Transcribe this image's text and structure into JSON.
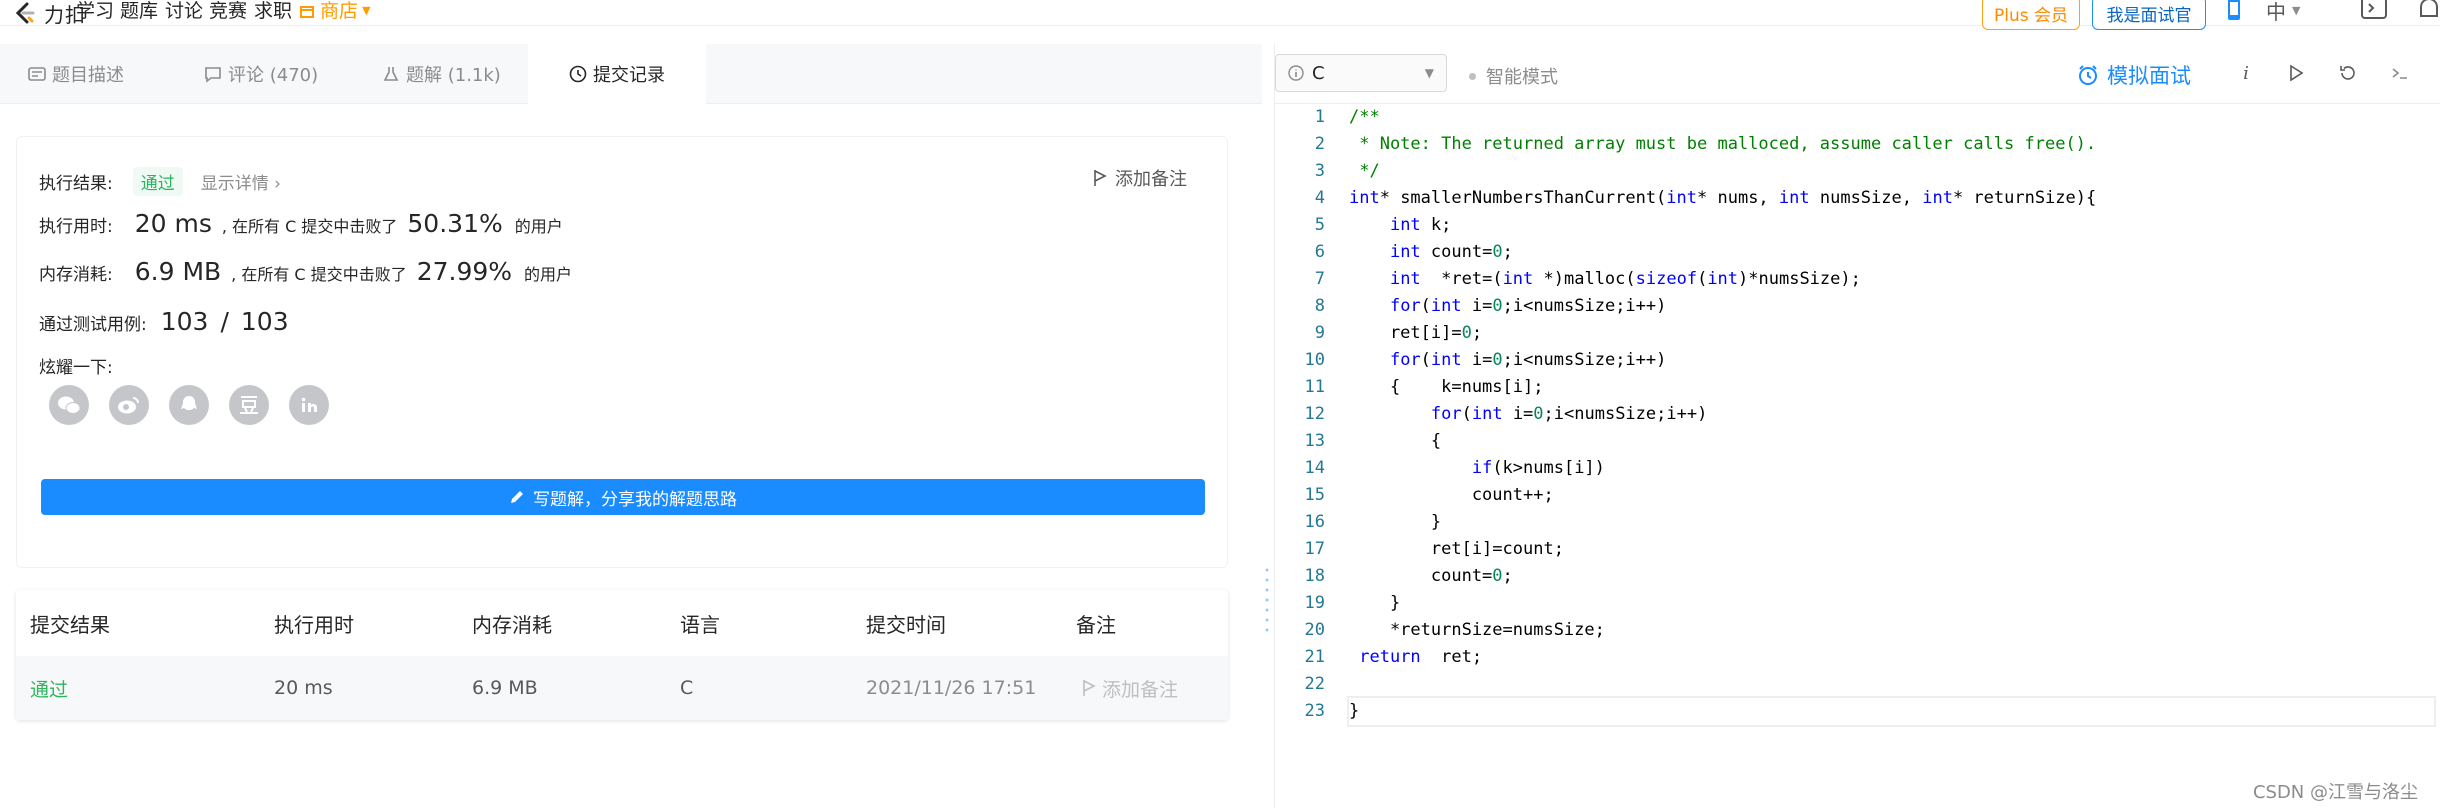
{
  "nav": {
    "logo_text": "力扣",
    "items": [
      "学习",
      "题库",
      "讨论",
      "竞赛",
      "求职"
    ],
    "store": "商店",
    "plus": "Plus 会员",
    "interviewer": "我是面试官",
    "lang": "中"
  },
  "tabs": [
    {
      "label": "题目描述",
      "icon": "description-icon"
    },
    {
      "label": "评论 (470)",
      "icon": "comment-icon"
    },
    {
      "label": "题解 (1.1k)",
      "icon": "flask-icon"
    },
    {
      "label": "提交记录",
      "icon": "clock-icon"
    }
  ],
  "result": {
    "status_label": "执行结果:",
    "status_value": "通过",
    "detail_link": "显示详情",
    "add_note": "添加备注",
    "runtime_label": "执行用时:",
    "runtime_value": "20 ms",
    "runtime_text": ", 在所有 C 提交中击败了",
    "runtime_pct": "50.31%",
    "runtime_suffix": "的用户",
    "memory_label": "内存消耗:",
    "memory_value": "6.9 MB",
    "memory_text": ", 在所有 C 提交中击败了",
    "memory_pct": "27.99%",
    "memory_suffix": "的用户",
    "tests_label": "通过测试用例:",
    "tests_passed": "103",
    "tests_sep": "/",
    "tests_total": "103",
    "share_label": "炫耀一下:",
    "write_button": "写题解，分享我的解题思路"
  },
  "table": {
    "headers": [
      "提交结果",
      "执行用时",
      "内存消耗",
      "语言",
      "提交时间",
      "备注"
    ],
    "row": {
      "status": "通过",
      "runtime": "20 ms",
      "memory": "6.9 MB",
      "lang": "C",
      "time": "2021/11/26 17:51",
      "note": "添加备注"
    }
  },
  "editor": {
    "language": "C",
    "smart_mode": "智能模式",
    "mock_interview": "模拟面试",
    "line_numbers": [
      "1",
      "2",
      "3",
      "4",
      "5",
      "6",
      "7",
      "8",
      "9",
      "10",
      "11",
      "12",
      "13",
      "14",
      "15",
      "16",
      "17",
      "18",
      "19",
      "20",
      "21",
      "22",
      "23"
    ]
  },
  "watermark": "CSDN @江雪与洛尘",
  "colors": {
    "accent": "#1a8cff",
    "success": "#2db55d",
    "store": "#ff9c00"
  }
}
